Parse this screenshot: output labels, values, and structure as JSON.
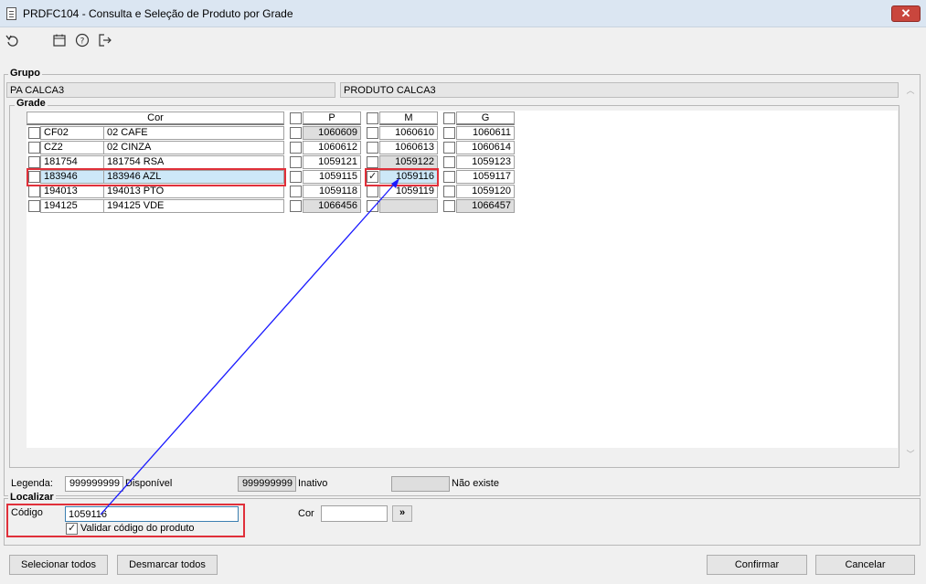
{
  "window": {
    "title": "PRDFC104 - Consulta e Seleção de Produto por Grade",
    "close_label": "✕"
  },
  "toolbar": {
    "icons": [
      "undo-icon",
      "calendar-icon",
      "help-icon",
      "exit-icon"
    ]
  },
  "grupo": {
    "label": "Grupo",
    "code": "PA CALCA3",
    "description": "PRODUTO CALCA3"
  },
  "grade": {
    "label": "Grade",
    "color_header": "Cor",
    "sizes": [
      "P",
      "M",
      "G"
    ],
    "rows": [
      {
        "code": "CF02",
        "name": "02 CAFE",
        "cells": [
          "1060609",
          "1060610",
          "1060611"
        ]
      },
      {
        "code": "CZ2",
        "name": "02 CINZA",
        "cells": [
          "1060612",
          "1060613",
          "1060614"
        ]
      },
      {
        "code": "181754",
        "name": "181754 RSA",
        "cells": [
          "1059121",
          "1059122",
          "1059123"
        ]
      },
      {
        "code": "183946",
        "name": "183946 AZL",
        "cells": [
          "1059115",
          "1059116",
          "1059117"
        ]
      },
      {
        "code": "194013",
        "name": "194013 PTO",
        "cells": [
          "1059118",
          "1059119",
          "1059120"
        ]
      },
      {
        "code": "194125",
        "name": "194125 VDE",
        "cells": [
          "1066456",
          "",
          "1066457"
        ]
      }
    ]
  },
  "legenda": {
    "label": "Legenda:",
    "available_sample": "999999999",
    "available_label": "Disponível",
    "inactive_sample": "999999999",
    "inactive_label": "Inativo",
    "notexist_label": "Não existe"
  },
  "localizar": {
    "label": "Localizar",
    "codigo_label": "Código",
    "codigo_value": "1059116",
    "validar_label": "Validar código do produto",
    "validar_checked": true,
    "cor_label": "Cor",
    "cor_value": "",
    "go_label": "»"
  },
  "buttons": {
    "select_all": "Selecionar todos",
    "deselect_all": "Desmarcar todos",
    "confirm": "Confirmar",
    "cancel": "Cancelar"
  },
  "colors": {
    "highlight": "#e0303a",
    "arrow": "#1a1aff",
    "selected_row": "#cde8f8"
  }
}
